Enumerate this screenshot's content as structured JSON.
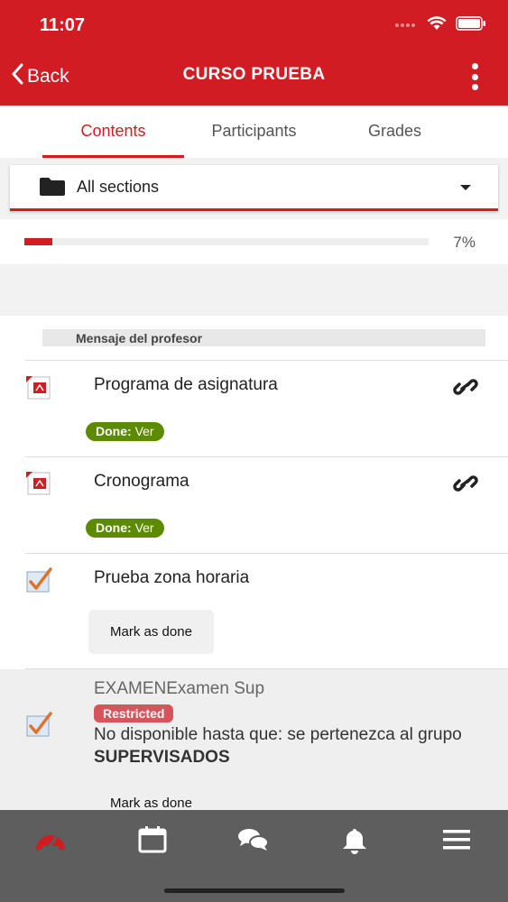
{
  "status_bar": {
    "time": "11:07"
  },
  "header": {
    "back_label": "Back",
    "title": "CURSO PRUEBA"
  },
  "tabs": [
    {
      "label": "Contents",
      "active": true
    },
    {
      "label": "Participants",
      "active": false
    },
    {
      "label": "Grades",
      "active": false
    }
  ],
  "section_selector": {
    "label": "All sections"
  },
  "progress": {
    "value": 0.07,
    "label": "7%"
  },
  "message": {
    "label": "Mensaje del profesor"
  },
  "items": [
    {
      "title": "Programa de asignatura",
      "icon": "pdf-icon",
      "done_label": "Done:",
      "done_value": "Ver"
    },
    {
      "title": "Cronograma",
      "icon": "pdf-icon",
      "done_label": "Done:",
      "done_value": "Ver"
    },
    {
      "title": "Prueba zona horaria",
      "icon": "checkbox-icon",
      "button_label": "Mark as done"
    },
    {
      "title": "EXAMENExamen Sup",
      "icon": "checkbox-icon",
      "badge": "Restricted",
      "restriction_text": "No disponible hasta que: se pertenezca al grupo",
      "restriction_group": "SUPERVISADOS",
      "button_label": "Mark as done"
    }
  ],
  "colors": {
    "accent": "#d01c22",
    "done": "#5c8a00",
    "restricted": "#d6545b",
    "tabbar": "#5e5e5e"
  },
  "tabbar": {
    "items": [
      "dashboard-icon",
      "calendar-icon",
      "messages-icon",
      "notifications-icon",
      "menu-icon"
    ]
  }
}
